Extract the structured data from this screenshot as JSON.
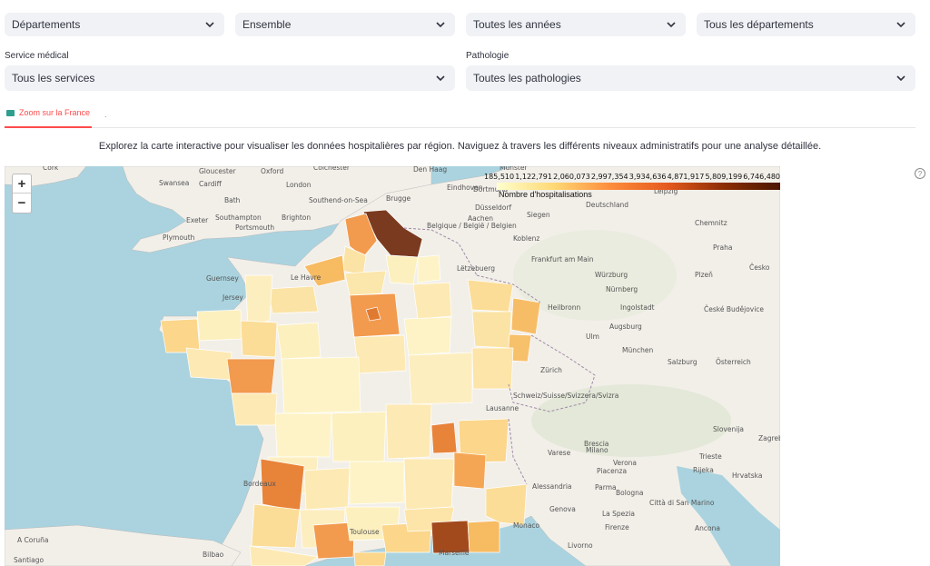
{
  "filters_row1": [
    {
      "label": "Départements"
    },
    {
      "label": "Ensemble"
    },
    {
      "label": "Toutes les années"
    },
    {
      "label": "Tous les départements"
    }
  ],
  "service": {
    "caption": "Service médical",
    "value": "Tous les services"
  },
  "pathologie": {
    "caption": "Pathologie",
    "value": "Toutes les pathologies"
  },
  "tabs": [
    {
      "label": "Zoom sur la France"
    }
  ],
  "tab_extra": ".",
  "description": "Explorez la carte interactive pour visualiser les données hospitalières par région. Naviguez à travers les différents niveaux administratifs pour une analyse détaillée.",
  "help_icon": "?",
  "map": {
    "zoom_in": "+",
    "zoom_out": "−",
    "legend": {
      "ticks": [
        "185,510",
        "1,122,791",
        "2,060,073",
        "2,997,354",
        "3,934,636",
        "4,871,917",
        "5,809,199",
        "6,746,480"
      ],
      "title": "Nombre d'hospitalisations",
      "colors": [
        "#ffffcc",
        "#fed976",
        "#fd8d3c",
        "#e65a1e",
        "#8c2d04",
        "#4a1502"
      ]
    },
    "place_labels": [
      "Cork",
      "Gloucester",
      "Oxford",
      "Colchester",
      "Den Haag",
      "Münster",
      "Swansea",
      "Cardiff",
      "London",
      "Southend-on-Sea",
      "Brugge",
      "Eindhoven",
      "Bath",
      "Dortmund",
      "Düsseldorf",
      "Leipzig",
      "Chemnitz",
      "Exeter",
      "Southampton",
      "Brighton",
      "Aachen",
      "Siegen",
      "Plymouth",
      "Portsmouth",
      "Belgique / België / Belgien",
      "Deutschland",
      "Koblenz",
      "Praha",
      "Guernsey",
      "Jersey",
      "Le Havre",
      "Lëtzebuerg",
      "Frankfurt am Main",
      "Würzburg",
      "Plzeň",
      "Česko",
      "Nürnberg",
      "Heilbronn",
      "Ingolstadt",
      "České Budějovice",
      "Augsburg",
      "Ulm",
      "München",
      "Salzburg",
      "Österreich",
      "Zürich",
      "Schweiz/Suisse/Svizzera/Svizra",
      "Lausanne",
      "Slovenija",
      "Zagreb",
      "Varese",
      "Brescia",
      "Verona",
      "Trieste",
      "Rijeka",
      "Hrvatska",
      "Milano",
      "Piacenza",
      "Alessandria",
      "Parma",
      "Bologna",
      "Genova",
      "Città di San Marino",
      "Firenze",
      "Ancona",
      "Bordeaux",
      "Marseille",
      "Toulouse",
      "A Coruña",
      "Bilbao",
      "Santiago",
      "Monaco",
      "La Spezia",
      "Livorno"
    ]
  }
}
